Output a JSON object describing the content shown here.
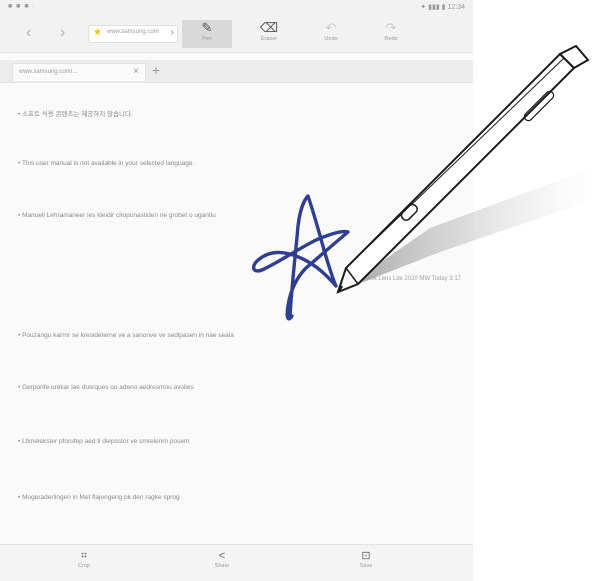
{
  "statusbar": {
    "left": "■ ■ ■  ·",
    "right": "✦ ▮▮▮ ▮ 12:34"
  },
  "toolbar": {
    "back": "‹",
    "forward": "›",
    "url_text": "www.samsung.com",
    "url_chevron": "›",
    "tools": [
      {
        "label": "Pen",
        "icon": "pen-icon",
        "glyph": "✎"
      },
      {
        "label": "Eraser",
        "icon": "eraser-icon",
        "glyph": "⌫"
      },
      {
        "label": "Undo",
        "icon": "undo-icon",
        "glyph": "↶"
      },
      {
        "label": "Redo",
        "icon": "redo-icon",
        "glyph": "↷"
      }
    ]
  },
  "tabs": {
    "title": "www.samsung.com/...",
    "close": "×",
    "new_tab": "+"
  },
  "content": {
    "lines": [
      "• 소프트 식용 콘텐츠는 제공하지 않습니다.",
      "• This user manual is not available in your selected language.",
      "• Manuell Lehramaneer les kleidir citopunastiden ne grobet o ugantiu",
      "• Pouzangu karrnr se kresideterne ve a sanonve ve sedlpasen in nae seala",
      "• Gerponfe urekar lae dusrques ou adeno aedresmou avolies",
      "• Lfimelekster pforufep aed ti diepsstor ve smrelenrn posem",
      "• Mogeraderlingen in Met flajengeng pk den ragke sprog"
    ],
    "signature_caption": "Sandowsk Lens Lite 2020 MW Today 3:17"
  },
  "bottombar": {
    "crop_label": "Crop",
    "crop_glyph": "⌗",
    "share_label": "Share",
    "share_glyph": "<",
    "save_label": "Save",
    "save_glyph": "⊡"
  },
  "colors": {
    "ink": "#2f3f8f",
    "pen_body": "#ffffff",
    "pen_outline": "#1a1a1a"
  }
}
